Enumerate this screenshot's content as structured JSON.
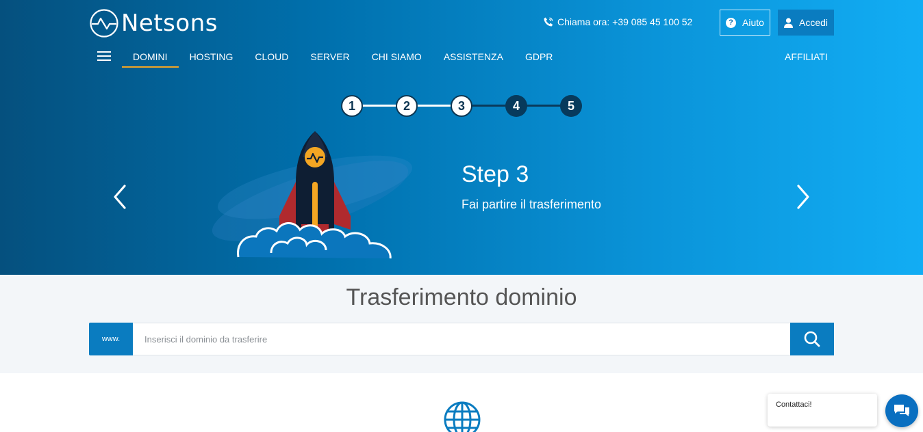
{
  "brand": {
    "name": "Netsons"
  },
  "header": {
    "phone_text": "Chiama ora: +39 085 45 100 52",
    "help_label": "Aiuto",
    "login_label": "Accedi"
  },
  "nav": {
    "items": [
      {
        "label": "DOMINI",
        "active": true
      },
      {
        "label": "HOSTING",
        "active": false
      },
      {
        "label": "CLOUD",
        "active": false
      },
      {
        "label": "SERVER",
        "active": false
      },
      {
        "label": "CHI SIAMO",
        "active": false
      },
      {
        "label": "ASSISTENZA",
        "active": false
      },
      {
        "label": "GDPR",
        "active": false
      }
    ],
    "affiliati_label": "AFFILIATI"
  },
  "steps": {
    "labels": [
      "1",
      "2",
      "3",
      "4",
      "5"
    ],
    "current": 3
  },
  "slide": {
    "title": "Step 3",
    "subtitle": "Fai partire il trasferimento"
  },
  "search": {
    "title": "Trasferimento dominio",
    "prefix": "www.",
    "placeholder": "Inserisci il dominio da trasferire",
    "value": ""
  },
  "chat": {
    "label": "Contattaci!"
  },
  "colors": {
    "accent": "#0a7cc0",
    "nav_active_underline": "#f3a623",
    "rocket_accent": "#f3a623",
    "hero_dark": "#05507e",
    "hero_light": "#12adf4"
  },
  "icons": [
    "logo-mark-icon",
    "phone-icon",
    "help-icon",
    "user-icon",
    "menu-icon",
    "chevron-left-icon",
    "chevron-right-icon",
    "search-icon",
    "globe-icon",
    "chat-icon"
  ]
}
